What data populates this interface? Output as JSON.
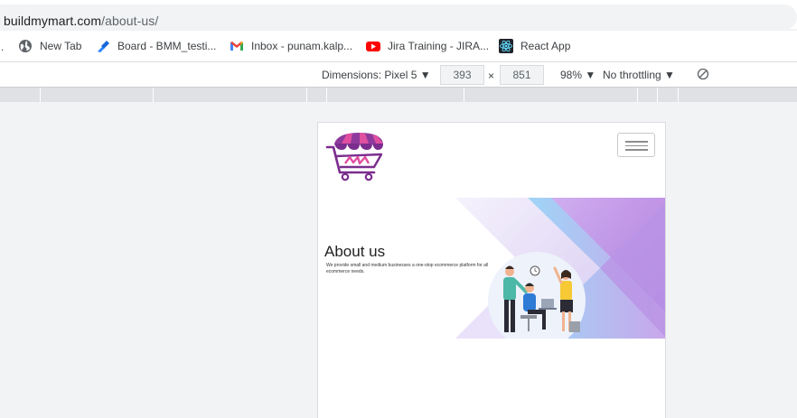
{
  "browser": {
    "url_host": "buildmymart.com",
    "url_path": "/about-us/"
  },
  "bookmarks": [
    {
      "label": "New Tab",
      "icon": "globe-icon"
    },
    {
      "label": "Board - BMM_testi...",
      "icon": "jira-icon"
    },
    {
      "label": "Inbox - punam.kalp...",
      "icon": "gmail-icon"
    },
    {
      "label": "Jira Training - JIRA...",
      "icon": "youtube-icon"
    },
    {
      "label": "React App",
      "icon": "react-icon"
    }
  ],
  "devtools": {
    "device_label": "Dimensions: Pixel 5 ▼",
    "width": "393",
    "height": "851",
    "times": "×",
    "zoom": "98% ▼",
    "throttling": "No throttling ▼"
  },
  "site": {
    "title": "About us",
    "description": "We provide small and medium businesses a one-stop ecommerce platform for all ecommerce needs."
  },
  "colors": {
    "logo_purple": "#7b2d8e",
    "logo_pink": "#e04fa0",
    "hero_lavender": "#c7b3ec"
  }
}
